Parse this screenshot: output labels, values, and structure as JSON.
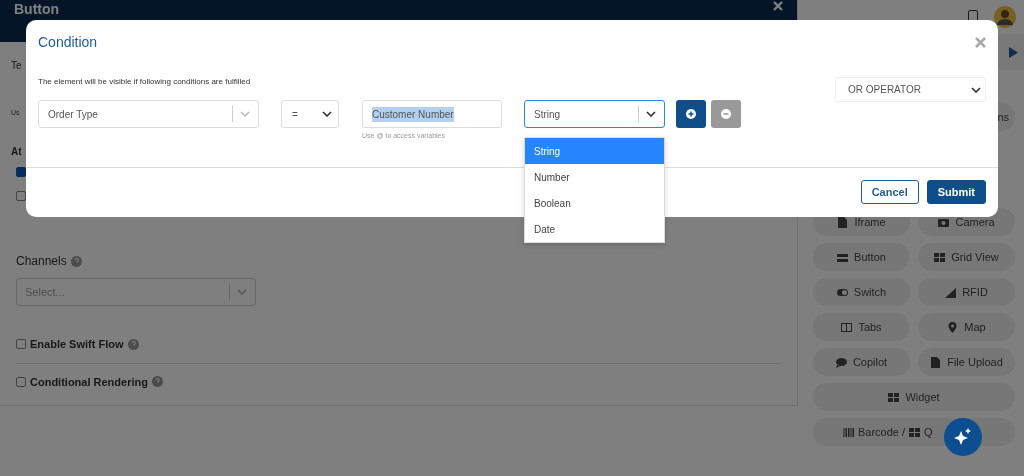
{
  "background": {
    "panel_title": "Button",
    "fragments": [
      "Te",
      "Us",
      "At"
    ],
    "checkboxes": [
      {
        "checked": true
      },
      {
        "checked": false
      }
    ],
    "channels": {
      "label": "Channels",
      "placeholder": "Select..."
    },
    "options": [
      {
        "label": "Enable Swift Flow",
        "checked": false
      },
      {
        "label": "Conditional Rendering",
        "checked": false
      }
    ]
  },
  "palette": {
    "fragment": "ns",
    "items": [
      {
        "label": "Iframe",
        "kind": "file"
      },
      {
        "label": "Camera",
        "kind": "camera"
      },
      {
        "label": "Button",
        "kind": "button"
      },
      {
        "label": "Grid View",
        "kind": "grid"
      },
      {
        "label": "Switch",
        "kind": "toggle"
      },
      {
        "label": "RFID",
        "kind": "signal"
      },
      {
        "label": "Tabs",
        "kind": "columns"
      },
      {
        "label": "Map",
        "kind": "pin"
      },
      {
        "label": "Copilot",
        "kind": "chat"
      },
      {
        "label": "File Upload",
        "kind": "file"
      },
      {
        "label": "Widget",
        "kind": "grid",
        "wide": true
      },
      {
        "label": "Barcode /",
        "kind": "barcode",
        "wide": true,
        "tail": "Q"
      }
    ]
  },
  "modal": {
    "title": "Condition",
    "hint": "The element will be visible if following conditions are fulfilled",
    "field": {
      "value": "Order Type"
    },
    "operator": {
      "value": "="
    },
    "value_input": {
      "value": "Customer Number",
      "highlighted": true,
      "help": "Use @ to access variables"
    },
    "type_select": {
      "value": "String",
      "open": true,
      "options": [
        {
          "label": "String",
          "selected": true
        },
        {
          "label": "Number",
          "selected": false
        },
        {
          "label": "Boolean",
          "selected": false
        },
        {
          "label": "Date",
          "selected": false
        }
      ]
    },
    "logic": {
      "value": "OR OPERATOR"
    },
    "buttons": [
      {
        "label": "Cancel",
        "kind": "outline"
      },
      {
        "label": "Submit",
        "kind": "primary"
      }
    ]
  }
}
